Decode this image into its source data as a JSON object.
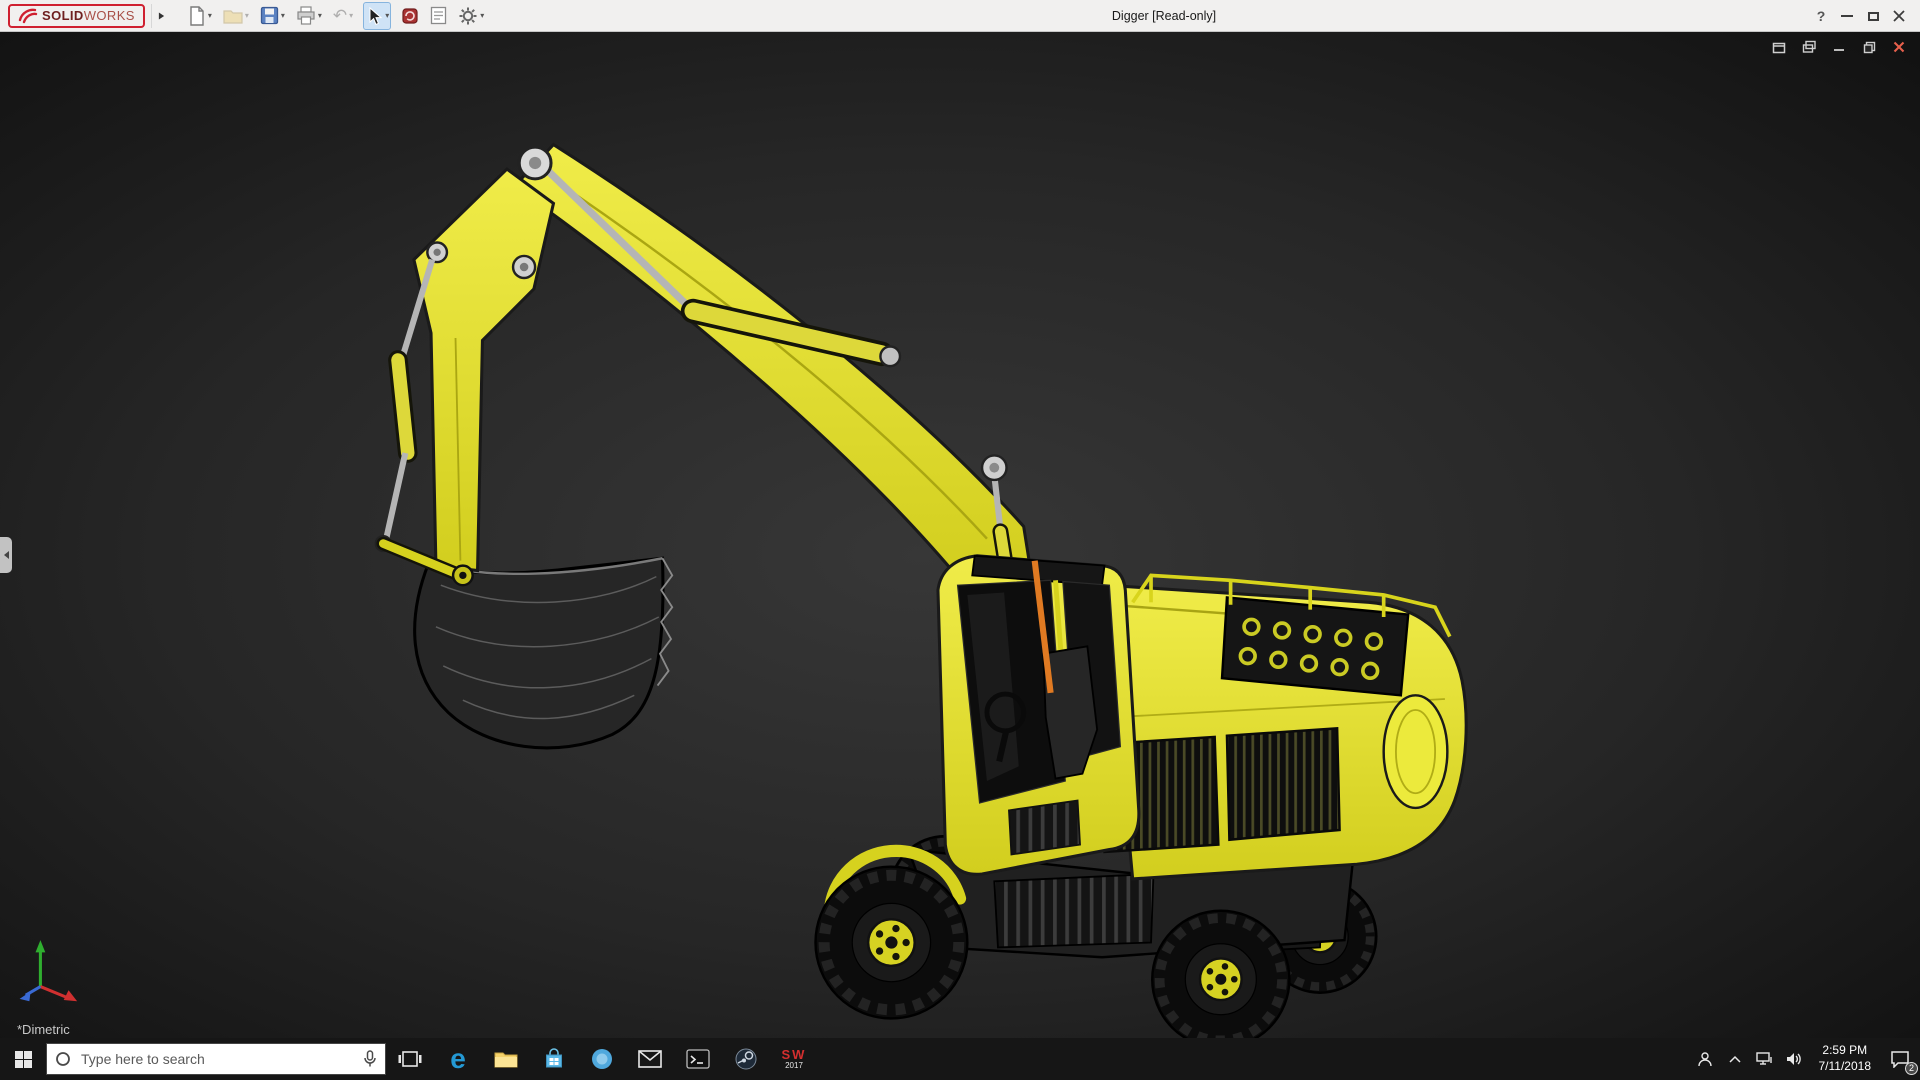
{
  "titlebar": {
    "brand_solid": "SOLID",
    "brand_works": "WORKS",
    "title": "Digger [Read-only]",
    "help_label": "?",
    "toolbar_icons": [
      "new-document",
      "open-folder",
      "save",
      "print",
      "undo",
      "select-cursor",
      "rebuild",
      "file-properties",
      "options-gear"
    ],
    "window_controls": [
      "help",
      "minimize",
      "maximize",
      "close"
    ]
  },
  "viewport": {
    "orientation_label": "*Dimetric",
    "doc_window_icons": [
      "new-window",
      "cascade-windows",
      "minimize-doc",
      "restore-doc",
      "close-doc"
    ],
    "model_name": "excavator"
  },
  "taskbar": {
    "search_placeholder": "Type here to search",
    "edge_glyph": "e",
    "sw_line1": "SW",
    "sw_line2": "2017",
    "time": "2:59 PM",
    "date": "7/11/2018",
    "notification_count": "2",
    "app_icons": [
      "start",
      "cortana-search",
      "microphone",
      "task-view",
      "edge",
      "file-explorer",
      "store",
      "blue-circle-app",
      "mail",
      "command-prompt",
      "dark-circle-app",
      "solidworks-2017"
    ],
    "tray_icons": [
      "people",
      "hidden-icons-chevron",
      "network",
      "volume",
      "clock",
      "action-center"
    ]
  },
  "colors": {
    "excavator_yellow": "#e8e42c",
    "titlebar_bg": "#f1f0ef",
    "taskbar_bg": "#161616",
    "viewport_bg": "#262626",
    "brand_red": "#cf2030"
  }
}
